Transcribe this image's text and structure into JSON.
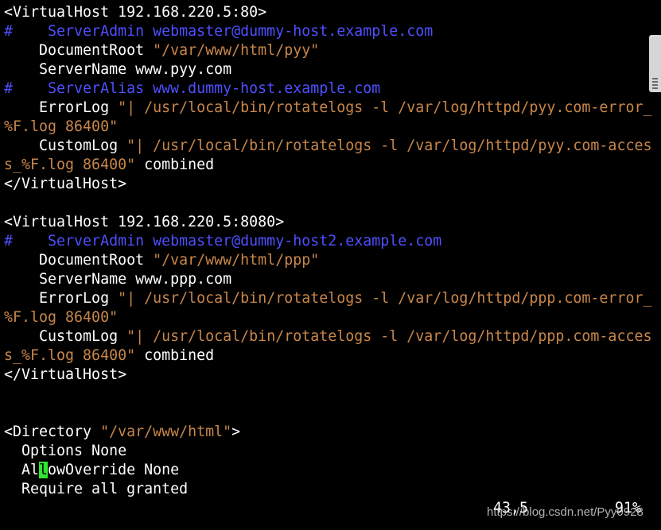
{
  "editor": {
    "lines": [
      [
        {
          "t": "<VirtualHost 192.168.220.5:80>",
          "s": "plain"
        }
      ],
      [
        {
          "t": "#    ServerAdmin webmaster@dummy-host.example.com",
          "s": "comment"
        }
      ],
      [
        {
          "t": "    DocumentRoot ",
          "s": "plain"
        },
        {
          "t": "\"/var/www/html/pyy\"",
          "s": "string"
        }
      ],
      [
        {
          "t": "    ServerName www.pyy.com",
          "s": "plain"
        }
      ],
      [
        {
          "t": "#    ServerAlias www.dummy-host.example.com",
          "s": "comment"
        }
      ],
      [
        {
          "t": "    ErrorLog ",
          "s": "plain"
        },
        {
          "t": "\"| /usr/local/bin/rotatelogs -l /var/log/httpd/pyy.com-error_",
          "s": "string"
        }
      ],
      [
        {
          "t": "%F.log 86400\"",
          "s": "string"
        }
      ],
      [
        {
          "t": "    CustomLog ",
          "s": "plain"
        },
        {
          "t": "\"| /usr/local/bin/rotatelogs -l /var/log/httpd/pyy.com-acces",
          "s": "string"
        }
      ],
      [
        {
          "t": "s_%F.log 86400\"",
          "s": "string"
        },
        {
          "t": " combined",
          "s": "plain"
        }
      ],
      [
        {
          "t": "</VirtualHost>",
          "s": "plain"
        }
      ],
      [],
      [
        {
          "t": "<VirtualHost 192.168.220.5:8080>",
          "s": "plain"
        }
      ],
      [
        {
          "t": "#    ServerAdmin webmaster@dummy-host2.example.com",
          "s": "comment"
        }
      ],
      [
        {
          "t": "    DocumentRoot ",
          "s": "plain"
        },
        {
          "t": "\"/var/www/html/ppp\"",
          "s": "string"
        }
      ],
      [
        {
          "t": "    ServerName www.ppp.com",
          "s": "plain"
        }
      ],
      [
        {
          "t": "    ErrorLog ",
          "s": "plain"
        },
        {
          "t": "\"| /usr/local/bin/rotatelogs -l /var/log/httpd/ppp.com-error_",
          "s": "string"
        }
      ],
      [
        {
          "t": "%F.log 86400\"",
          "s": "string"
        }
      ],
      [
        {
          "t": "    CustomLog ",
          "s": "plain"
        },
        {
          "t": "\"| /usr/local/bin/rotatelogs -l /var/log/httpd/ppp.com-acces",
          "s": "string"
        }
      ],
      [
        {
          "t": "s_%F.log 86400\"",
          "s": "string"
        },
        {
          "t": " combined",
          "s": "plain"
        }
      ],
      [
        {
          "t": "</VirtualHost>",
          "s": "plain"
        }
      ],
      [],
      [],
      [
        {
          "t": "<Directory ",
          "s": "plain"
        },
        {
          "t": "\"/var/www/html\"",
          "s": "string"
        },
        {
          "t": ">",
          "s": "plain"
        }
      ],
      [
        {
          "t": "  Options None",
          "s": "plain"
        }
      ],
      [
        {
          "t": "  Al",
          "s": "plain"
        },
        {
          "t": "l",
          "s": "cursor"
        },
        {
          "t": "owOverride None",
          "s": "plain"
        }
      ],
      [
        {
          "t": "  Require all granted",
          "s": "plain"
        }
      ]
    ]
  },
  "ruler": {
    "position": "43,5",
    "percent": "91%"
  },
  "watermark": "https://blog.csdn.net/Pyy0928",
  "colors": {
    "background": "#000000",
    "text": "#ffffff",
    "comment": "#4f4fff",
    "string": "#c8864a",
    "cursor": "#2ee62e"
  }
}
